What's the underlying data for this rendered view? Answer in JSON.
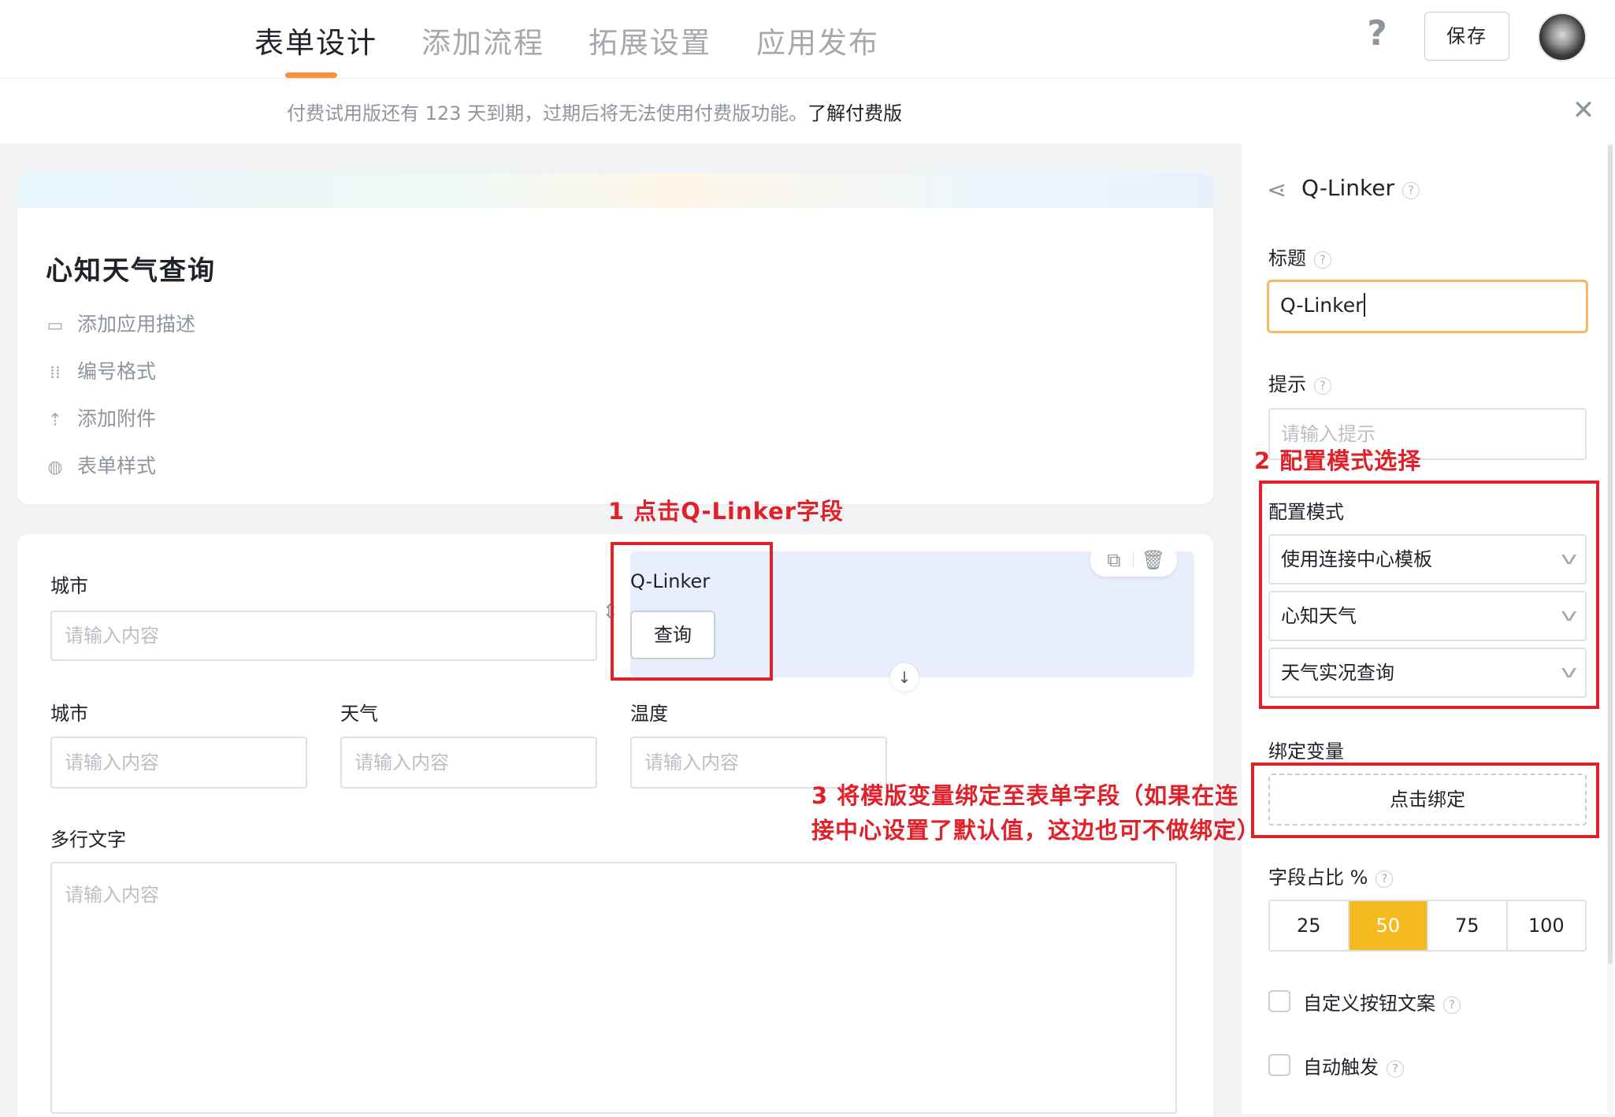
{
  "tabs": [
    {
      "label": "表单设计",
      "active": true
    },
    {
      "label": "添加流程"
    },
    {
      "label": "拓展设置"
    },
    {
      "label": "应用发布"
    }
  ],
  "header": {
    "help": "?",
    "save_label": "保存"
  },
  "banner": {
    "text": "付费试用版还有 123 天到期，过期后将无法使用付费版功能。",
    "link": "了解付费版",
    "close": "✕"
  },
  "app": {
    "title": "心知天气查询",
    "meta_items": [
      {
        "label": "添加应用描述",
        "icon": "comment-icon"
      },
      {
        "label": "编号格式",
        "icon": "number-format-icon"
      },
      {
        "label": "添加附件",
        "icon": "upload-icon"
      },
      {
        "label": "表单样式",
        "icon": "palette-icon"
      }
    ]
  },
  "form": {
    "city_label": "城市",
    "city_placeholder": "请输入内容",
    "qlinker_label": "Q-Linker",
    "query_button": "查询",
    "city2_label": "城市",
    "weather_label": "天气",
    "temp_label": "温度",
    "multiline_label": "多行文字",
    "placeholder": "请输入内容"
  },
  "panel": {
    "title": "Q-Linker",
    "title_label": "标题",
    "title_value": "Q-Linker",
    "hint_label": "提示",
    "hint_placeholder": "请输入提示",
    "config_mode_label": "配置模式",
    "selects": [
      "使用连接中心模板",
      "心知天气",
      "天气实况查询"
    ],
    "bind_label": "绑定变量",
    "bind_button": "点击绑定",
    "width_label": "字段占比 %",
    "width_options": [
      "25",
      "50",
      "75",
      "100"
    ],
    "width_selected": "50",
    "custom_button_label": "自定义按钮文案",
    "auto_trigger_label": "自动触发"
  },
  "annotations": {
    "step1": "1 点击Q-Linker字段",
    "step2": "2 配置模式选择",
    "step3_line1": "3 将模版变量绑定至表单字段（如果在连",
    "step3_line2": "接中心设置了默认值，这边也可不做绑定）"
  },
  "colors": {
    "accent": "#f7913d",
    "selected_segment": "#f4bb20",
    "annotation_red": "#e0212a",
    "field_selected_bg": "#e8eefc"
  }
}
